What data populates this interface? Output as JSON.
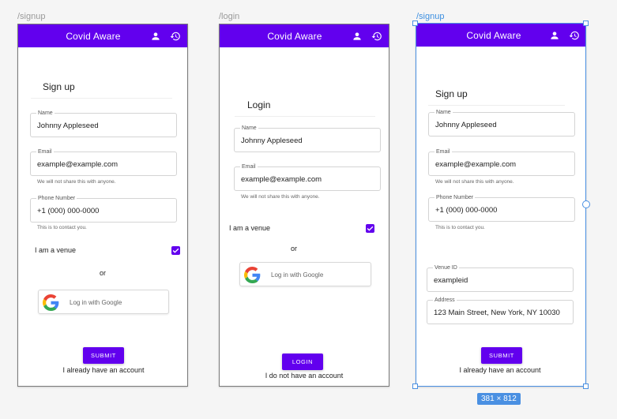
{
  "colors": {
    "primary": "#6200ee",
    "selection": "#4a90e2",
    "canvas": "#f5f5f5"
  },
  "frames": [
    {
      "route": "/signup",
      "app_title": "Covid Aware",
      "icons": [
        "account-icon",
        "history-icon"
      ],
      "title": "Sign up",
      "name": {
        "label": "Name",
        "value": "Johnny Appleseed"
      },
      "email": {
        "label": "Email",
        "value": "example@example.com",
        "helper": "We will not share this with anyone."
      },
      "phone": {
        "label": "Phone Number",
        "value": "+1 (000) 000-0000",
        "helper": "This is to contact you."
      },
      "venue_label": "I am a venue",
      "venue_checked": true,
      "or_text": "or",
      "google_label": "Log in with Google",
      "submit_label": "SUBMIT",
      "alt_link": "I already have an account"
    },
    {
      "route": "/login",
      "app_title": "Covid Aware",
      "icons": [
        "account-icon",
        "history-icon"
      ],
      "title": "Login",
      "name": {
        "label": "Name",
        "value": "Johnny Appleseed"
      },
      "email": {
        "label": "Email",
        "value": "example@example.com",
        "helper": "We will not share this with anyone."
      },
      "venue_label": "I am a venue",
      "venue_checked": true,
      "or_text": "or",
      "google_label": "Log in with Google",
      "submit_label": "LOGIN",
      "alt_link": "I do not have an account"
    },
    {
      "route": "/signup",
      "app_title": "Covid Aware",
      "icons": [
        "account-icon",
        "history-icon"
      ],
      "title": "Sign up",
      "name": {
        "label": "Name",
        "value": "Johnny Appleseed"
      },
      "email": {
        "label": "Email",
        "value": "example@example.com",
        "helper": "We will not share this with anyone."
      },
      "phone": {
        "label": "Phone Number",
        "value": "+1 (000) 000-0000",
        "helper": "This is to contact you."
      },
      "venue_id": {
        "label": "Venue ID",
        "value": "exampleid"
      },
      "address": {
        "label": "Address",
        "value": "123 Main Street, New York, NY 10030"
      },
      "submit_label": "SUBMIT",
      "alt_link": "I already have an account",
      "selected": true,
      "size_badge": "381 × 812"
    }
  ]
}
